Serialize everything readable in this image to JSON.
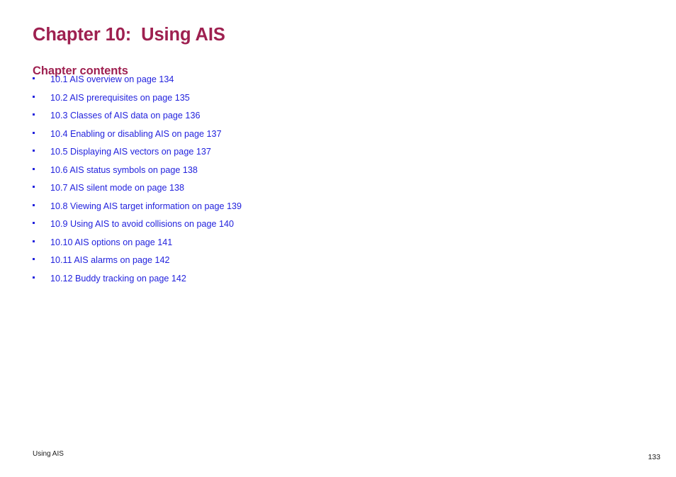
{
  "document": {
    "chapter_title": "Chapter 10:  Using AIS",
    "contents_heading": "Chapter contents",
    "bullet_glyph": "square-bullet",
    "contents": [
      {
        "label": "10.1 AIS overview on page 134"
      },
      {
        "label": "10.2 AIS prerequisites on page 135"
      },
      {
        "label": "10.3 Classes of AIS data on page 136"
      },
      {
        "label": "10.4 Enabling or disabling AIS on page 137"
      },
      {
        "label": "10.5 Displaying AIS vectors on page 137"
      },
      {
        "label": "10.6 AIS status symbols on page 138"
      },
      {
        "label": "10.7 AIS silent mode on page 138"
      },
      {
        "label": "10.8 Viewing AIS target information on page 139"
      },
      {
        "label": "10.9 Using AIS to avoid collisions on page 140"
      },
      {
        "label": "10.10 AIS options on page 141"
      },
      {
        "label": "10.11 AIS alarms on page 142"
      },
      {
        "label": "10.12 Buddy tracking on page 142"
      }
    ]
  },
  "footer": {
    "running_head": "Using AIS",
    "page_number": "133"
  },
  "colors": {
    "heading": "#9e2050",
    "link": "#2222dd",
    "footer_text": "#1a1a1a",
    "background": "#ffffff"
  }
}
